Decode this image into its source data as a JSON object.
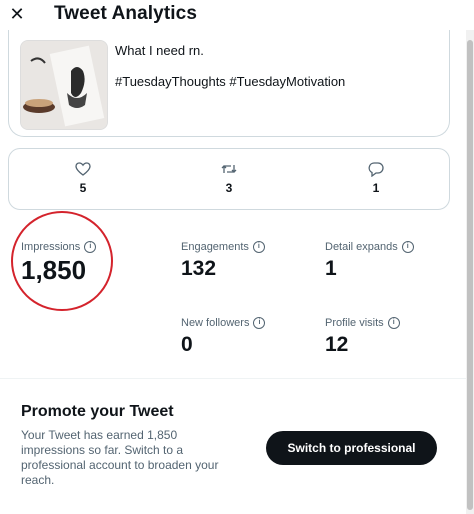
{
  "header": {
    "close_icon": "close-icon",
    "title": "Tweet Analytics"
  },
  "tweet": {
    "text": "What I need rn.",
    "hashtags": "#TuesdayThoughts #TuesdayMotivation"
  },
  "stats": {
    "likes": {
      "icon": "heart-icon",
      "value": "5"
    },
    "retweets": {
      "icon": "retweet-icon",
      "value": "3"
    },
    "replies": {
      "icon": "reply-icon",
      "value": "1"
    }
  },
  "metrics": {
    "impressions": {
      "label": "Impressions",
      "value": "1,850"
    },
    "engagements": {
      "label": "Engagements",
      "value": "132"
    },
    "detail_expands": {
      "label": "Detail expands",
      "value": "1"
    },
    "new_followers": {
      "label": "New followers",
      "value": "0"
    },
    "profile_visits": {
      "label": "Profile visits",
      "value": "12"
    }
  },
  "promo": {
    "title": "Promote your Tweet",
    "body": "Your Tweet has earned 1,850 impressions so far. Switch to a professional account to broaden your reach.",
    "button_label": "Switch to professional"
  },
  "colors": {
    "annotation_circle": "#d4232c",
    "button_bg": "#0f1419",
    "muted_text": "#536471"
  }
}
